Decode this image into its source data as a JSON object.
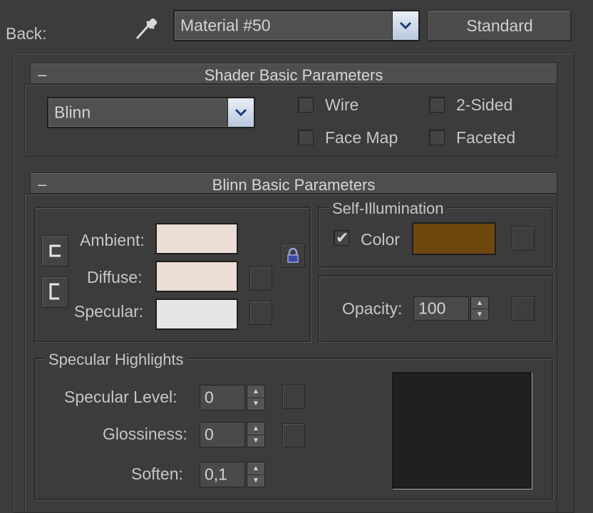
{
  "toolbar": {
    "back_label": "Back:",
    "material_name": "Material #50",
    "material_type_button": "Standard"
  },
  "shader_rollout": {
    "collapse_glyph": "–",
    "title": "Shader Basic Parameters",
    "shader_type": "Blinn",
    "options": [
      {
        "label": "Wire",
        "checked": false
      },
      {
        "label": "2-Sided",
        "checked": false
      },
      {
        "label": "Face Map",
        "checked": false
      },
      {
        "label": "Faceted",
        "checked": false
      }
    ]
  },
  "blinn_rollout": {
    "collapse_glyph": "–",
    "title": "Blinn Basic Parameters",
    "ambient_label": "Ambient:",
    "diffuse_label": "Diffuse:",
    "specular_label": "Specular:",
    "colors": {
      "ambient": "#ecddd5",
      "diffuse": "#ecddd5",
      "specular": "#e6e6e6"
    },
    "self_illumination": {
      "title": "Self-Illumination",
      "color_checked": true,
      "color_label": "Color",
      "color": "#6e470f"
    },
    "opacity": {
      "label": "Opacity:",
      "value": "100"
    },
    "specular_highlights": {
      "title": "Specular Highlights",
      "specular_level_label": "Specular Level:",
      "specular_level_value": "0",
      "glossiness_label": "Glossiness:",
      "glossiness_value": "0",
      "soften_label": "Soften:",
      "soften_value": "0,1",
      "curve_preview_color": "#202020"
    }
  },
  "icons": {
    "eyedropper": "eyedropper-icon",
    "dropdown_arrow": "chevron-down-icon",
    "lock": "lock-icon",
    "link_top": "link-bracket-icon",
    "link_bottom": "link-bracket-icon"
  }
}
